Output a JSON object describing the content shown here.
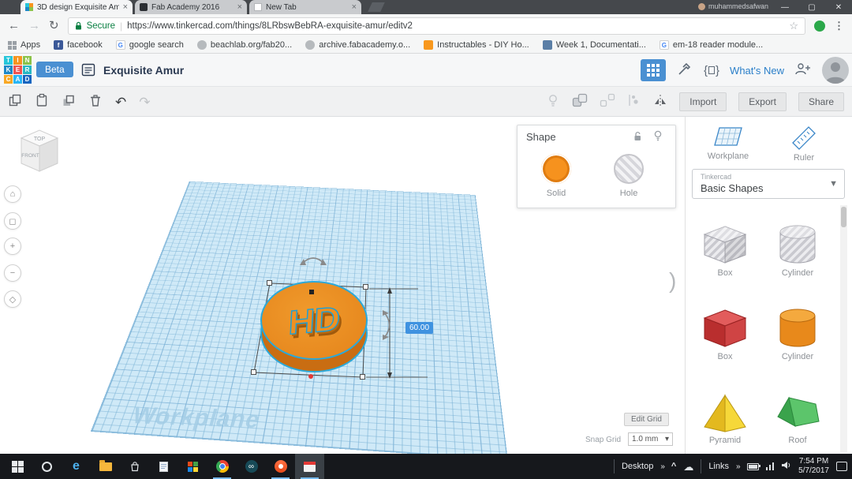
{
  "browser": {
    "profile_name": "muhammedsafwan",
    "tabs": [
      {
        "title": "3D design Exquisite Amu"
      },
      {
        "title": "Fab Academy 2016"
      },
      {
        "title": "New Tab"
      }
    ],
    "nav": {
      "secure_label": "Secure",
      "url": "https://www.tinkercad.com/things/8LRbswBebRA-exquisite-amur/editv2"
    },
    "bookmarks": [
      "Apps",
      "facebook",
      "google search",
      "beachlab.org/fab20...",
      "archive.fabacademy.o...",
      "Instructables - DIY Ho...",
      "Week 1, Documentati...",
      "em-18 reader module..."
    ]
  },
  "tinkercad": {
    "logo_letters": [
      "T",
      "I",
      "N",
      "K",
      "E",
      "R",
      "C",
      "A",
      "D"
    ],
    "beta_label": "Beta",
    "design_title": "Exquisite Amur",
    "whats_new_label": "What's New",
    "import_label": "Import",
    "export_label": "Export",
    "share_label": "Share"
  },
  "shape_panel": {
    "title": "Shape",
    "solid_label": "Solid",
    "hole_label": "Hole"
  },
  "canvas": {
    "watermark": "Workplane",
    "object_label": "HD",
    "dimension_value": "60.00",
    "edit_grid_label": "Edit Grid",
    "snap_grid_label": "Snap Grid",
    "snap_grid_value": "1.0 mm",
    "viewcube": {
      "top": "TOP",
      "front": "FRONT"
    }
  },
  "sidebar": {
    "workplane_label": "Workplane",
    "ruler_label": "Ruler",
    "category_kicker": "Tinkercad",
    "category_value": "Basic Shapes",
    "shapes": [
      {
        "label": "Box"
      },
      {
        "label": "Cylinder"
      },
      {
        "label": "Box"
      },
      {
        "label": "Cylinder"
      },
      {
        "label": "Pyramid"
      },
      {
        "label": "Roof"
      }
    ]
  },
  "taskbar": {
    "desktop_label": "Desktop",
    "links_label": "Links",
    "time": "7:54 PM",
    "date": "5/7/2017"
  },
  "colors": {
    "accent_blue": "#4a90d2",
    "selection_cyan": "#29abe2",
    "solid_orange": "#f6921e",
    "secure_green": "#0b8043",
    "workplane_blue": "#cfe9f7"
  }
}
